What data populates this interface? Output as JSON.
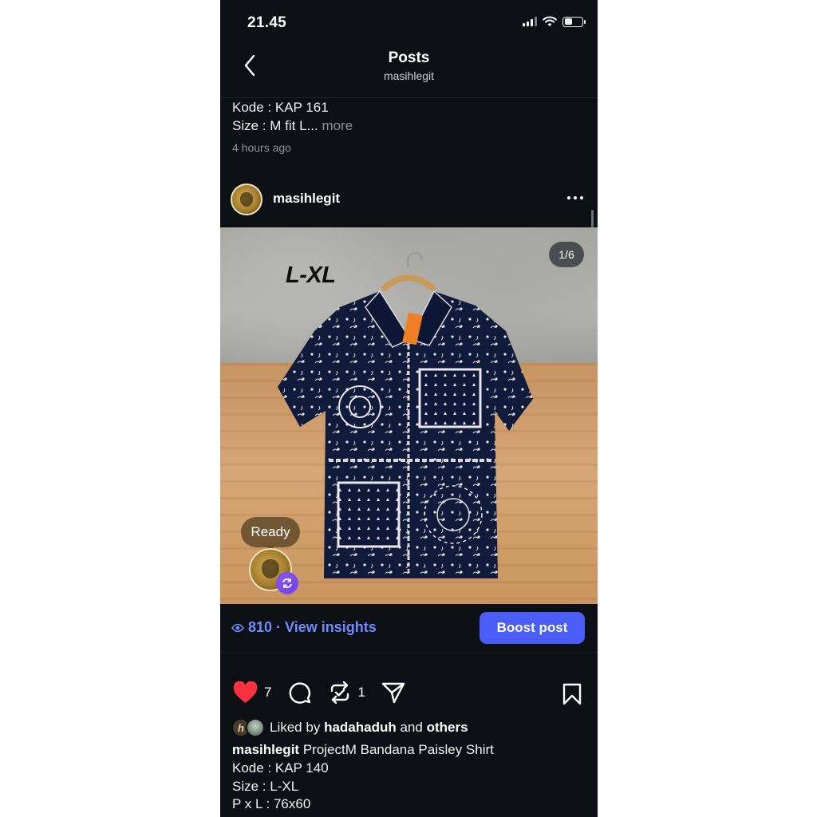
{
  "status_bar": {
    "time": "21.45"
  },
  "header": {
    "title": "Posts",
    "subtitle": "masihlegit"
  },
  "previous_post": {
    "caption_lines": [
      "Kode : KAP 161",
      "Size : M fit L..."
    ],
    "more_label": "more",
    "time_ago": "4 hours ago"
  },
  "post": {
    "username": "masihlegit",
    "image_text": "L-XL",
    "page_indicator": "1/6",
    "note_bubble": "Ready",
    "views": "810",
    "view_insights_label": "· View insights",
    "boost_label": "Boost post",
    "carousel": {
      "total": 6,
      "active": 1
    },
    "likes_count": "7",
    "reposts_count": "1",
    "liked_by_prefix": "Liked by",
    "liked_by_user": "hadahaduh",
    "liked_by_and": "and",
    "liked_by_others": "others",
    "caption_user": "masihlegit",
    "caption_lines": [
      "ProjectM Bandana Paisley Shirt",
      "Kode : KAP 140",
      "Size : L-XL",
      "P x L : 76x60"
    ]
  },
  "icons": [
    "back-icon",
    "signal-icon",
    "wifi-icon",
    "battery-icon",
    "more-icon",
    "eye-icon",
    "heart-icon",
    "comment-icon",
    "repost-icon",
    "share-icon",
    "bookmark-icon"
  ],
  "colors": {
    "background": "#0c1014",
    "accent": "#4a5df9",
    "link": "#6c8cff",
    "like": "#ff3040"
  }
}
